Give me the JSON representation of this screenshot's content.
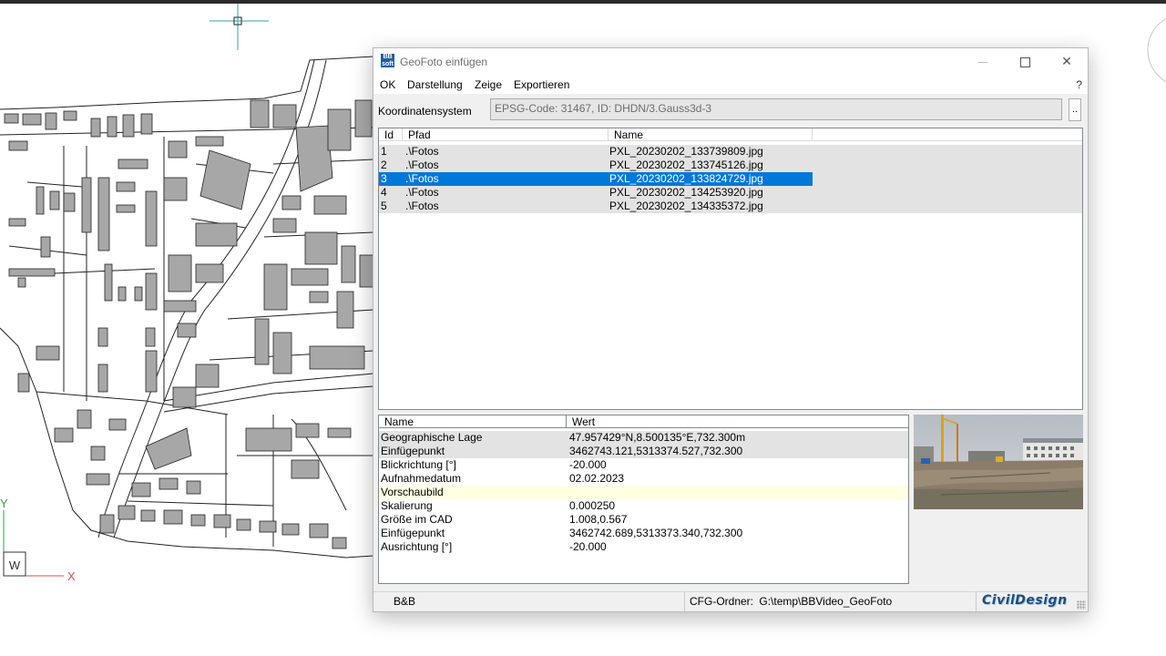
{
  "window": {
    "title": "GeoFoto einfügen",
    "icon": "bb-soft-app-icon"
  },
  "menu": {
    "items": [
      "OK",
      "Darstellung",
      "Zeige",
      "Exportieren"
    ],
    "help": "?"
  },
  "coord_system": {
    "label": "Koordinatensystem",
    "value": "EPSG-Code: 31467, ID: DHDN/3.Gauss3d-3",
    "browse_label": ".."
  },
  "photo_list": {
    "columns": [
      "Id",
      "Pfad",
      "Name"
    ],
    "rows": [
      {
        "id": "1",
        "path": ".\\Fotos",
        "name": "PXL_20230202_133739809.jpg",
        "selected": false
      },
      {
        "id": "2",
        "path": ".\\Fotos",
        "name": "PXL_20230202_133745126.jpg",
        "selected": false
      },
      {
        "id": "3",
        "path": ".\\Fotos",
        "name": "PXL_20230202_133824729.jpg",
        "selected": true
      },
      {
        "id": "4",
        "path": ".\\Fotos",
        "name": "PXL_20230202_134253920.jpg",
        "selected": false
      },
      {
        "id": "5",
        "path": ".\\Fotos",
        "name": "PXL_20230202_134335372.jpg",
        "selected": false
      }
    ]
  },
  "properties": {
    "columns": [
      "Name",
      "Wert"
    ],
    "rows": [
      {
        "name": "Geographische Lage",
        "value": "47.957429°N,8.500135°E,732.300m",
        "style": "gray"
      },
      {
        "name": "Einfügepunkt",
        "value": "3462743.121,5313374.527,732.300",
        "style": "gray"
      },
      {
        "name": "Blickrichtung [°]",
        "value": "-20.000",
        "style": "white"
      },
      {
        "name": "Aufnahmedatum",
        "value": "02.02.2023",
        "style": "white"
      },
      {
        "name": "Vorschaubild",
        "value": "",
        "style": "yellow"
      },
      {
        "name": "Skalierung",
        "value": "0.000250",
        "style": "white"
      },
      {
        "name": "Größe im CAD",
        "value": "1.008,0.567",
        "style": "white"
      },
      {
        "name": "Einfügepunkt",
        "value": "3462742.689,5313373.340,732.300",
        "style": "white"
      },
      {
        "name": "Ausrichtung [°]",
        "value": "-20.000",
        "style": "white"
      }
    ]
  },
  "status": {
    "left": "B&B",
    "cfg_label": "CFG-Ordner:",
    "cfg_path": "G:\\temp\\BBVideo_GeoFoto",
    "logo": "CivilDesign"
  },
  "cad": {
    "ucs_w": "W",
    "axis_x": "X",
    "axis_y": "Y",
    "colors": {
      "building": "#a7a7a7",
      "line": "#222222",
      "ucs_green": "#2ea043",
      "ucs_red": "#d9534f",
      "crosshair": "#2aa3a3"
    }
  },
  "colors": {
    "selection": "#0078d7",
    "row_gray": "#e3e3e3",
    "row_yellow": "#ffffe1"
  }
}
